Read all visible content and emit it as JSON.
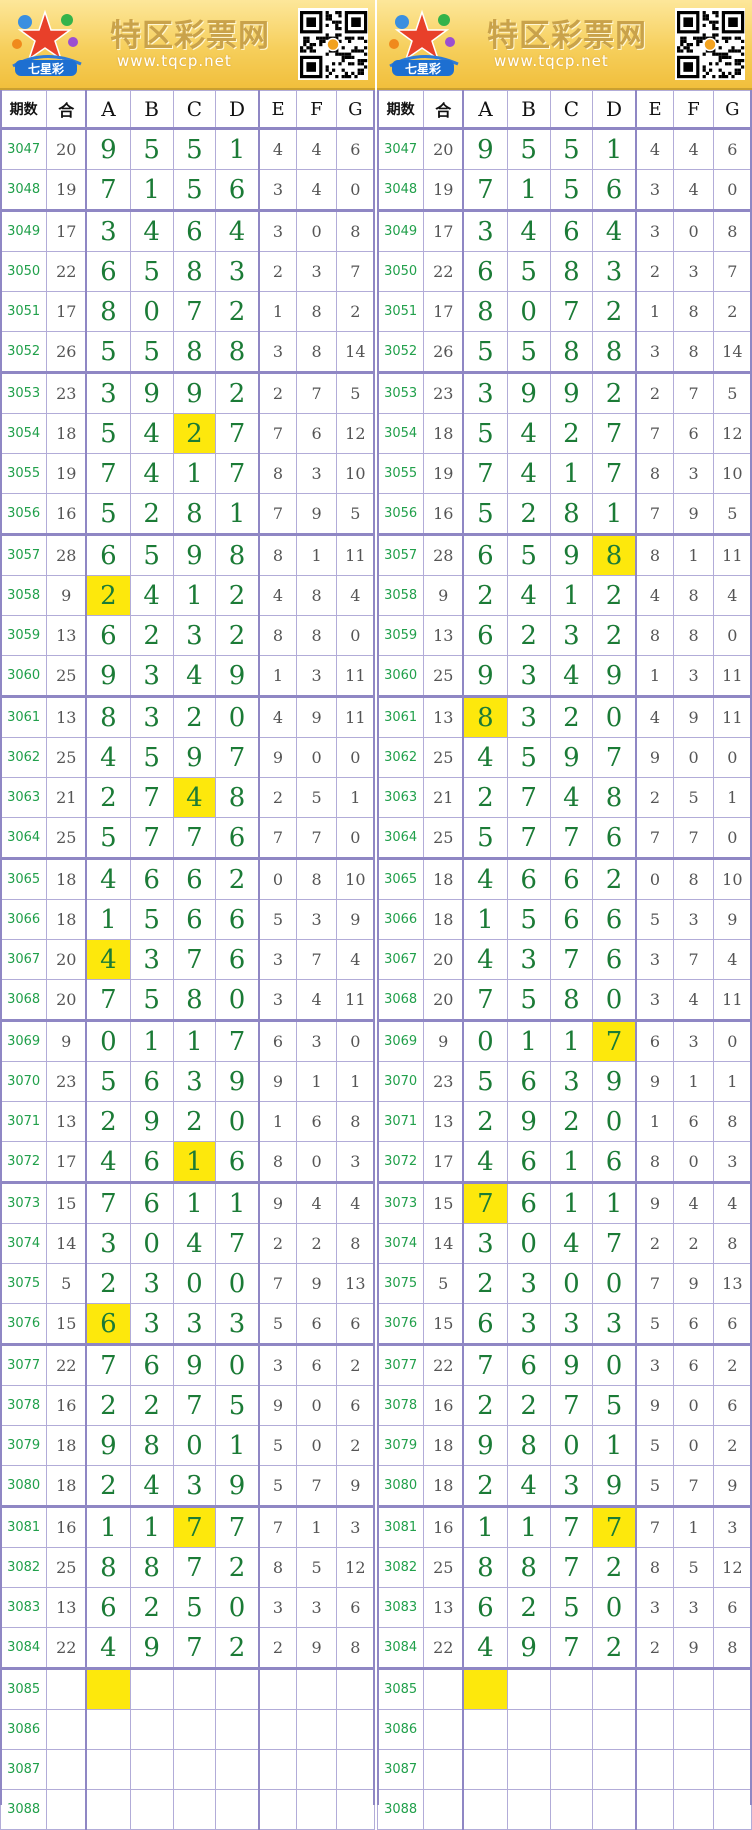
{
  "site": {
    "title": "特区彩票网",
    "url": "www.tqcp.net",
    "logo_text": "七星彩"
  },
  "headers": [
    "期数",
    "合",
    "A",
    "B",
    "C",
    "D",
    "E",
    "F",
    "G"
  ],
  "colors": {
    "highlight": "#fde80c",
    "main_digit": "#1b7b36",
    "issue": "#21a04b",
    "grid_line": "#8f87c4",
    "banner": "#f6cf5c"
  },
  "rows": [
    {
      "issue": "3047",
      "sum": "20",
      "a": "9",
      "b": "5",
      "c": "5",
      "d": "1",
      "e": "4",
      "f": "4",
      "g": "6"
    },
    {
      "issue": "3048",
      "sum": "19",
      "a": "7",
      "b": "1",
      "c": "5",
      "d": "6",
      "e": "3",
      "f": "4",
      "g": "0"
    },
    {
      "issue": "3049",
      "sum": "17",
      "a": "3",
      "b": "4",
      "c": "6",
      "d": "4",
      "e": "3",
      "f": "0",
      "g": "8"
    },
    {
      "issue": "3050",
      "sum": "22",
      "a": "6",
      "b": "5",
      "c": "8",
      "d": "3",
      "e": "2",
      "f": "3",
      "g": "7"
    },
    {
      "issue": "3051",
      "sum": "17",
      "a": "8",
      "b": "0",
      "c": "7",
      "d": "2",
      "e": "1",
      "f": "8",
      "g": "2"
    },
    {
      "issue": "3052",
      "sum": "26",
      "a": "5",
      "b": "5",
      "c": "8",
      "d": "8",
      "e": "3",
      "f": "8",
      "g": "14"
    },
    {
      "issue": "3053",
      "sum": "23",
      "a": "3",
      "b": "9",
      "c": "9",
      "d": "2",
      "e": "2",
      "f": "7",
      "g": "5"
    },
    {
      "issue": "3054",
      "sum": "18",
      "a": "5",
      "b": "4",
      "c": "2",
      "d": "7",
      "e": "7",
      "f": "6",
      "g": "12"
    },
    {
      "issue": "3055",
      "sum": "19",
      "a": "7",
      "b": "4",
      "c": "1",
      "d": "7",
      "e": "8",
      "f": "3",
      "g": "10"
    },
    {
      "issue": "3056",
      "sum": "16",
      "a": "5",
      "b": "2",
      "c": "8",
      "d": "1",
      "e": "7",
      "f": "9",
      "g": "5"
    },
    {
      "issue": "3057",
      "sum": "28",
      "a": "6",
      "b": "5",
      "c": "9",
      "d": "8",
      "e": "8",
      "f": "1",
      "g": "11"
    },
    {
      "issue": "3058",
      "sum": "9",
      "a": "2",
      "b": "4",
      "c": "1",
      "d": "2",
      "e": "4",
      "f": "8",
      "g": "4"
    },
    {
      "issue": "3059",
      "sum": "13",
      "a": "6",
      "b": "2",
      "c": "3",
      "d": "2",
      "e": "8",
      "f": "8",
      "g": "0"
    },
    {
      "issue": "3060",
      "sum": "25",
      "a": "9",
      "b": "3",
      "c": "4",
      "d": "9",
      "e": "1",
      "f": "3",
      "g": "11"
    },
    {
      "issue": "3061",
      "sum": "13",
      "a": "8",
      "b": "3",
      "c": "2",
      "d": "0",
      "e": "4",
      "f": "9",
      "g": "11"
    },
    {
      "issue": "3062",
      "sum": "25",
      "a": "4",
      "b": "5",
      "c": "9",
      "d": "7",
      "e": "9",
      "f": "0",
      "g": "0"
    },
    {
      "issue": "3063",
      "sum": "21",
      "a": "2",
      "b": "7",
      "c": "4",
      "d": "8",
      "e": "2",
      "f": "5",
      "g": "1"
    },
    {
      "issue": "3064",
      "sum": "25",
      "a": "5",
      "b": "7",
      "c": "7",
      "d": "6",
      "e": "7",
      "f": "7",
      "g": "0"
    },
    {
      "issue": "3065",
      "sum": "18",
      "a": "4",
      "b": "6",
      "c": "6",
      "d": "2",
      "e": "0",
      "f": "8",
      "g": "10"
    },
    {
      "issue": "3066",
      "sum": "18",
      "a": "1",
      "b": "5",
      "c": "6",
      "d": "6",
      "e": "5",
      "f": "3",
      "g": "9"
    },
    {
      "issue": "3067",
      "sum": "20",
      "a": "4",
      "b": "3",
      "c": "7",
      "d": "6",
      "e": "3",
      "f": "7",
      "g": "4"
    },
    {
      "issue": "3068",
      "sum": "20",
      "a": "7",
      "b": "5",
      "c": "8",
      "d": "0",
      "e": "3",
      "f": "4",
      "g": "11"
    },
    {
      "issue": "3069",
      "sum": "9",
      "a": "0",
      "b": "1",
      "c": "1",
      "d": "7",
      "e": "6",
      "f": "3",
      "g": "0"
    },
    {
      "issue": "3070",
      "sum": "23",
      "a": "5",
      "b": "6",
      "c": "3",
      "d": "9",
      "e": "9",
      "f": "1",
      "g": "1"
    },
    {
      "issue": "3071",
      "sum": "13",
      "a": "2",
      "b": "9",
      "c": "2",
      "d": "0",
      "e": "1",
      "f": "6",
      "g": "8"
    },
    {
      "issue": "3072",
      "sum": "17",
      "a": "4",
      "b": "6",
      "c": "1",
      "d": "6",
      "e": "8",
      "f": "0",
      "g": "3"
    },
    {
      "issue": "3073",
      "sum": "15",
      "a": "7",
      "b": "6",
      "c": "1",
      "d": "1",
      "e": "9",
      "f": "4",
      "g": "4"
    },
    {
      "issue": "3074",
      "sum": "14",
      "a": "3",
      "b": "0",
      "c": "4",
      "d": "7",
      "e": "2",
      "f": "2",
      "g": "8"
    },
    {
      "issue": "3075",
      "sum": "5",
      "a": "2",
      "b": "3",
      "c": "0",
      "d": "0",
      "e": "7",
      "f": "9",
      "g": "13"
    },
    {
      "issue": "3076",
      "sum": "15",
      "a": "6",
      "b": "3",
      "c": "3",
      "d": "3",
      "e": "5",
      "f": "6",
      "g": "6"
    },
    {
      "issue": "3077",
      "sum": "22",
      "a": "7",
      "b": "6",
      "c": "9",
      "d": "0",
      "e": "3",
      "f": "6",
      "g": "2"
    },
    {
      "issue": "3078",
      "sum": "16",
      "a": "2",
      "b": "2",
      "c": "7",
      "d": "5",
      "e": "9",
      "f": "0",
      "g": "6"
    },
    {
      "issue": "3079",
      "sum": "18",
      "a": "9",
      "b": "8",
      "c": "0",
      "d": "1",
      "e": "5",
      "f": "0",
      "g": "2"
    },
    {
      "issue": "3080",
      "sum": "18",
      "a": "2",
      "b": "4",
      "c": "3",
      "d": "9",
      "e": "5",
      "f": "7",
      "g": "9"
    },
    {
      "issue": "3081",
      "sum": "16",
      "a": "1",
      "b": "1",
      "c": "7",
      "d": "7",
      "e": "7",
      "f": "1",
      "g": "3"
    },
    {
      "issue": "3082",
      "sum": "25",
      "a": "8",
      "b": "8",
      "c": "7",
      "d": "2",
      "e": "8",
      "f": "5",
      "g": "12"
    },
    {
      "issue": "3083",
      "sum": "13",
      "a": "6",
      "b": "2",
      "c": "5",
      "d": "0",
      "e": "3",
      "f": "3",
      "g": "6"
    },
    {
      "issue": "3084",
      "sum": "22",
      "a": "4",
      "b": "9",
      "c": "7",
      "d": "2",
      "e": "2",
      "f": "9",
      "g": "8"
    },
    {
      "issue": "3085",
      "sum": "",
      "a": "",
      "b": "",
      "c": "",
      "d": "",
      "e": "",
      "f": "",
      "g": ""
    },
    {
      "issue": "3086",
      "sum": "",
      "a": "",
      "b": "",
      "c": "",
      "d": "",
      "e": "",
      "f": "",
      "g": ""
    },
    {
      "issue": "3087",
      "sum": "",
      "a": "",
      "b": "",
      "c": "",
      "d": "",
      "e": "",
      "f": "",
      "g": ""
    },
    {
      "issue": "3088",
      "sum": "",
      "a": "",
      "b": "",
      "c": "",
      "d": "",
      "e": "",
      "f": "",
      "g": ""
    }
  ],
  "highlights": {
    "left": [
      "3054:c",
      "3058:a",
      "3063:c",
      "3067:a",
      "3072:c",
      "3076:a",
      "3081:c",
      "3085:a"
    ],
    "right": [
      "3057:d",
      "3061:a",
      "3069:d",
      "3073:a",
      "3081:d",
      "3085:a"
    ]
  }
}
